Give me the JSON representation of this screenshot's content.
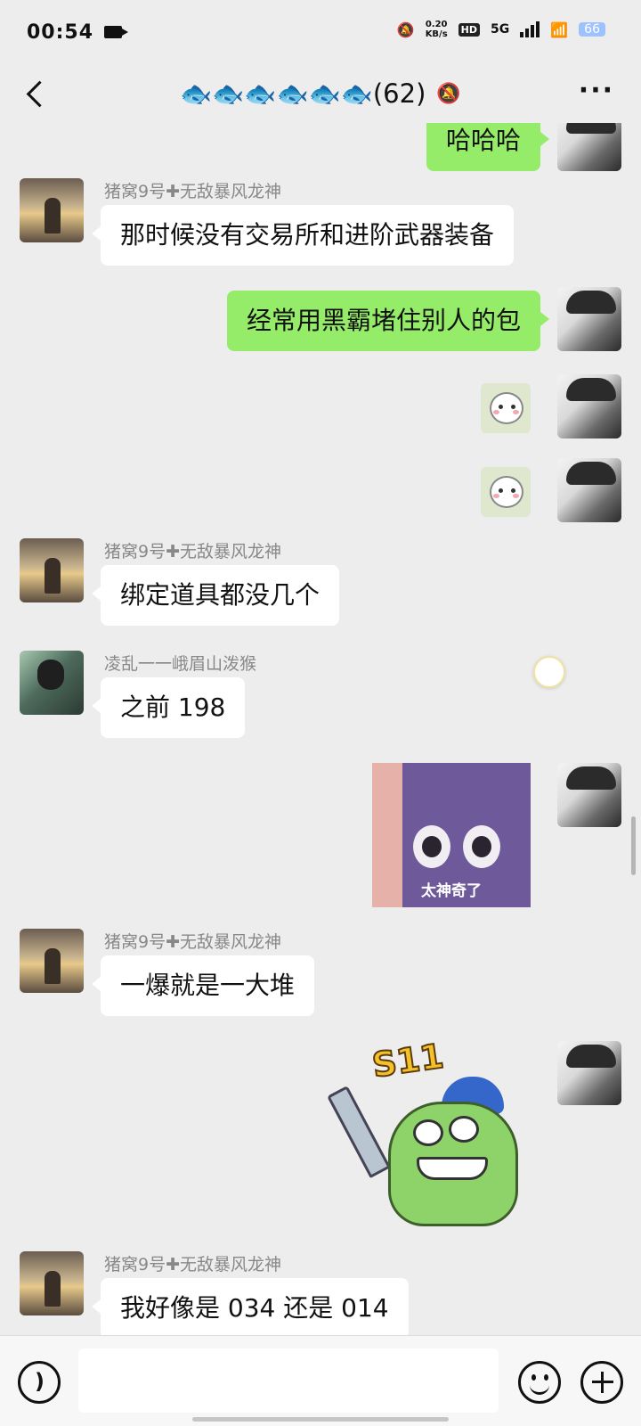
{
  "status_bar": {
    "time": "00:54",
    "net_speed_value": "0.20",
    "net_speed_unit": "KB/s",
    "hd_label": "HD",
    "network_label": "5G",
    "battery": "66"
  },
  "header": {
    "title": "🐟🐟🐟🐟🐟🐟(62)"
  },
  "messages": [
    {
      "side": "out",
      "kind": "text",
      "text": "哈哈哈"
    },
    {
      "side": "in",
      "kind": "text",
      "sender": "猪窝9号✚无敌暴风龙神",
      "text": "那时候没有交易所和进阶武器装备"
    },
    {
      "side": "out",
      "kind": "text",
      "text": "经常用黑霸堵住别人的包"
    },
    {
      "side": "out",
      "kind": "sticker",
      "icon": "cat-sticker"
    },
    {
      "side": "out",
      "kind": "sticker",
      "icon": "cat-sticker"
    },
    {
      "side": "in",
      "kind": "text",
      "sender": "猪窝9号✚无敌暴风龙神",
      "text": "绑定道具都没几个"
    },
    {
      "side": "in",
      "kind": "text",
      "sender": "凌乱一一峨眉山泼猴",
      "text": "之前 198"
    },
    {
      "side": "out",
      "kind": "sticker",
      "icon": "purple-face-sticker",
      "caption": "太神奇了"
    },
    {
      "side": "in",
      "kind": "text",
      "sender": "猪窝9号✚无敌暴风龙神",
      "text": "一爆就是一大堆"
    },
    {
      "side": "out",
      "kind": "sticker",
      "icon": "crocodile-sword-sticker",
      "caption": "S11"
    },
    {
      "side": "in",
      "kind": "text",
      "sender": "猪窝9号✚无敌暴风龙神",
      "text": "我好像是 034 还是 014"
    }
  ],
  "input_bar": {
    "placeholder": ""
  },
  "colors": {
    "chat_background": "#ededed",
    "outgoing_bubble": "#95ec69",
    "incoming_bubble": "#ffffff"
  }
}
